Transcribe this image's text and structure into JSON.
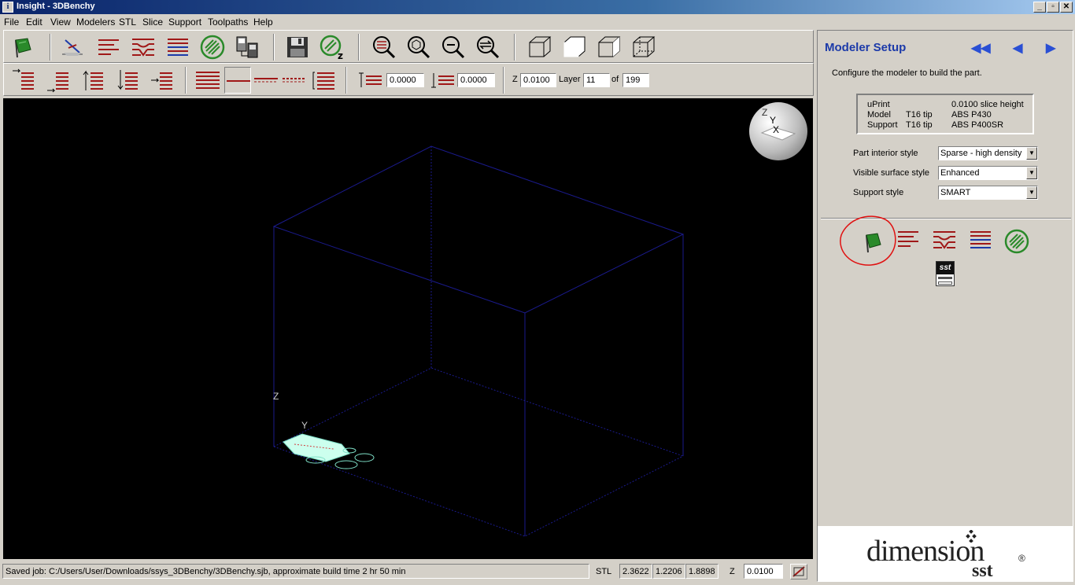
{
  "window": {
    "title": "Insight - 3DBenchy",
    "app_icon": "info-icon",
    "buttons": [
      "_",
      "▫",
      "✕"
    ]
  },
  "menu": [
    "File",
    "Edit",
    "View",
    "Modelers",
    "STL",
    "Slice",
    "Support",
    "Toolpaths",
    "Help"
  ],
  "toolbar2": {
    "offset_a": "0.0000",
    "offset_b": "0.0000",
    "z_label": "Z",
    "z_value": "0.0100",
    "layer_label": "Layer",
    "layer_value": "11",
    "of_label": "of",
    "layer_total": "199"
  },
  "viewport": {
    "axis_z": "Z",
    "axis_y": "Y",
    "orient_y": "Y",
    "orient_x": "X",
    "orient_z": "Z",
    "wire_color": "#1a1a8c",
    "part_color": "#7fe0c8"
  },
  "status": {
    "message": "Saved job:  C:/Users/User/Downloads/ssys_3DBenchy/3DBenchy.sjb,  approximate build time 2 hr 50 min",
    "stl_label": "STL",
    "stl_x": "2.3622",
    "stl_y": "1.2206",
    "stl_z": "1.8898",
    "z_label": "Z",
    "z_value": "0.0100"
  },
  "panel": {
    "title": "Modeler Setup",
    "subtitle": "Configure the modeler to build the part.",
    "info": {
      "modeler": "uPrint",
      "slice_height": "0.0100 slice height",
      "model_label": "Model",
      "model_tip": "T16 tip",
      "model_material": "ABS P430",
      "support_label": "Support",
      "support_tip": "T16 tip",
      "support_material": "ABS P400SR"
    },
    "options": [
      {
        "label": "Part interior style",
        "value": "Sparse - high density"
      },
      {
        "label": "Visible surface style",
        "value": "Enhanced"
      },
      {
        "label": "Support style",
        "value": "SMART"
      }
    ],
    "sst_label": "sst",
    "annotation_color": "#e01010"
  },
  "brand": {
    "name": "dimension",
    "registered": "®",
    "sub": "sst"
  },
  "colors": {
    "accent": "#1c3aa9",
    "toolbar_red": "#a01818",
    "green": "#2a8a2a"
  }
}
